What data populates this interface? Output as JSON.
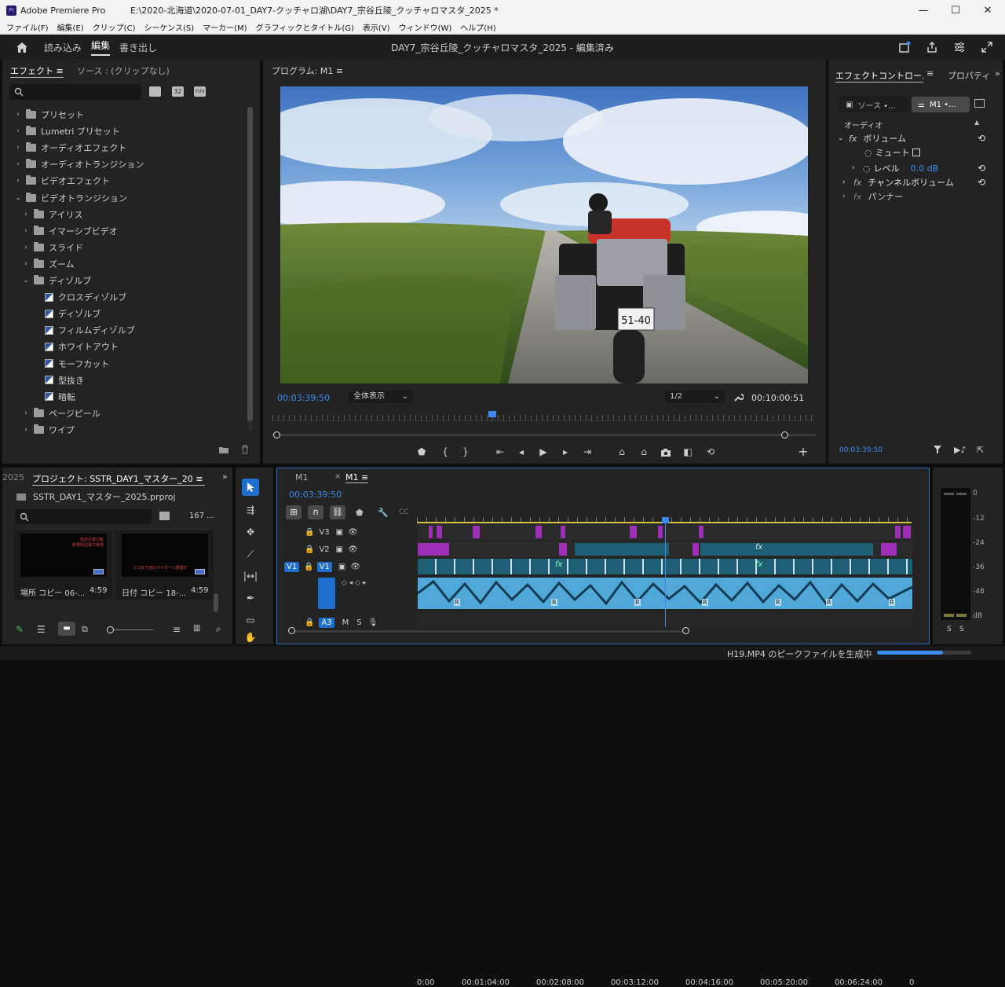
{
  "titlebar": {
    "app": "Adobe Premiere Pro",
    "path": "E:\\2020-北海道\\2020-07-01_DAY7-クッチャロ湖\\DAY7_宗谷丘陵_クッチャロマスタ_2025 *",
    "pr_badge": "Pr",
    "minimize": "—",
    "maximize": "☐",
    "close": "✕"
  },
  "menu": [
    "ファイル(F)",
    "編集(E)",
    "クリップ(C)",
    "シーケンス(S)",
    "マーカー(M)",
    "グラフィックとタイトル(G)",
    "表示(V)",
    "ウィンドウ(W)",
    "ヘルプ(H)"
  ],
  "workspace": {
    "tabs": [
      "読み込み",
      "編集",
      "書き出し"
    ],
    "active": "編集",
    "title": "DAY7_宗谷丘陵_クッチャロマスタ_2025 - 編集済み"
  },
  "effects": {
    "tab": "エフェクト",
    "tab2": "ソース : (クリップなし)",
    "badges": [
      "32",
      "YUV"
    ],
    "items": [
      {
        "label": "プリセット",
        "type": "folder",
        "level": 0,
        "open": false
      },
      {
        "label": "Lumetri プリセット",
        "type": "folder",
        "level": 0,
        "open": false
      },
      {
        "label": "オーディオエフェクト",
        "type": "folder",
        "level": 0,
        "open": false
      },
      {
        "label": "オーディオトランジション",
        "type": "folder",
        "level": 0,
        "open": false
      },
      {
        "label": "ビデオエフェクト",
        "type": "folder",
        "level": 0,
        "open": false
      },
      {
        "label": "ビデオトランジション",
        "type": "folder",
        "level": 0,
        "open": true
      },
      {
        "label": "アイリス",
        "type": "folder",
        "level": 1,
        "open": false
      },
      {
        "label": "イマーシブビデオ",
        "type": "folder",
        "level": 1,
        "open": false
      },
      {
        "label": "スライド",
        "type": "folder",
        "level": 1,
        "open": false
      },
      {
        "label": "ズーム",
        "type": "folder",
        "level": 1,
        "open": false
      },
      {
        "label": "ディゾルブ",
        "type": "folder",
        "level": 1,
        "open": true
      },
      {
        "label": "クロスディゾルブ",
        "type": "effect",
        "level": 2
      },
      {
        "label": "ディゾルブ",
        "type": "effect",
        "level": 2
      },
      {
        "label": "フィルムディゾルブ",
        "type": "effect",
        "level": 2
      },
      {
        "label": "ホワイトアウト",
        "type": "effect",
        "level": 2
      },
      {
        "label": "モーフカット",
        "type": "effect",
        "level": 2
      },
      {
        "label": "型抜き",
        "type": "effect",
        "level": 2
      },
      {
        "label": "暗転",
        "type": "effect",
        "level": 2
      },
      {
        "label": "ページピール",
        "type": "folder",
        "level": 1,
        "open": false
      },
      {
        "label": "ワイプ",
        "type": "folder",
        "level": 1,
        "open": false
      }
    ]
  },
  "program": {
    "title": "プログラム: M1",
    "timecode": "00:03:39:50",
    "fit": "全体表示",
    "resolution": "1/2",
    "duration": "00:10:00:51",
    "plate": "51-40",
    "playhead_fraction": 0.34
  },
  "effect_controls": {
    "tab": "エフェクトコントロール",
    "tab2": "プロパティ",
    "src_tab": "ソース •...",
    "seq_tab": "M1 •...",
    "section": "オーディオ",
    "volume": "ボリューム",
    "mute": "ミュート",
    "level_label": "レベル",
    "level_value": "0.0 dB",
    "channel": "チャンネルボリューム",
    "panner": "パンナー",
    "timecode": "00:03:39:50"
  },
  "project": {
    "tab": "プロジェクト: SSTR_DAY1_マスター_20",
    "edge_tab": "2025",
    "file": "SSTR_DAY1_マスター_2025.prproj",
    "count": "167 ...",
    "thumbs": [
      {
        "name": "場所 コピー 06-...",
        "dur": "4:59",
        "caption": "指定の道の駅\n新規所在事で発見"
      },
      {
        "name": "日付 コピー 18-...",
        "dur": "4:59",
        "caption": "ココまで他のライダーに遭遇す"
      }
    ]
  },
  "timeline": {
    "tab_inactive": "M1",
    "tab_active": "M1",
    "timecode": "00:03:39:50",
    "ticks": [
      "0:00",
      "00:01:04:00",
      "00:02:08:00",
      "00:03:12:00",
      "00:04:16:00",
      "00:05:20:00",
      "00:06:24:00",
      "0"
    ],
    "tracks": [
      {
        "name": "V3"
      },
      {
        "name": "V2"
      },
      {
        "name": "V1",
        "src": "V1"
      },
      {
        "name": "A3"
      }
    ],
    "fx": "fx",
    "r": "R",
    "mute": "M",
    "solo": "S",
    "playhead_fraction": 0.5
  },
  "meter": {
    "scale": [
      "0",
      "-12",
      "-24",
      "-36",
      "-48",
      "dB"
    ],
    "solo": [
      "S",
      "S"
    ]
  },
  "status": {
    "text": "H19.MP4 のピークファイルを生成中",
    "progress": 0.7
  },
  "icons": [
    "home-icon",
    "share-icon",
    "settings-icon",
    "fullscreen-icon",
    "search-icon",
    "folder-icon",
    "trash-icon",
    "wrench-icon",
    "play-icon",
    "marker-icon",
    "camera-icon",
    "add-icon",
    "selection-tool-icon",
    "razor-icon",
    "pen-icon",
    "hand-icon",
    "filter-icon",
    "eye-icon",
    "lock-icon",
    "pencil-icon",
    "list-icon",
    "grid-icon",
    "mic-icon"
  ]
}
